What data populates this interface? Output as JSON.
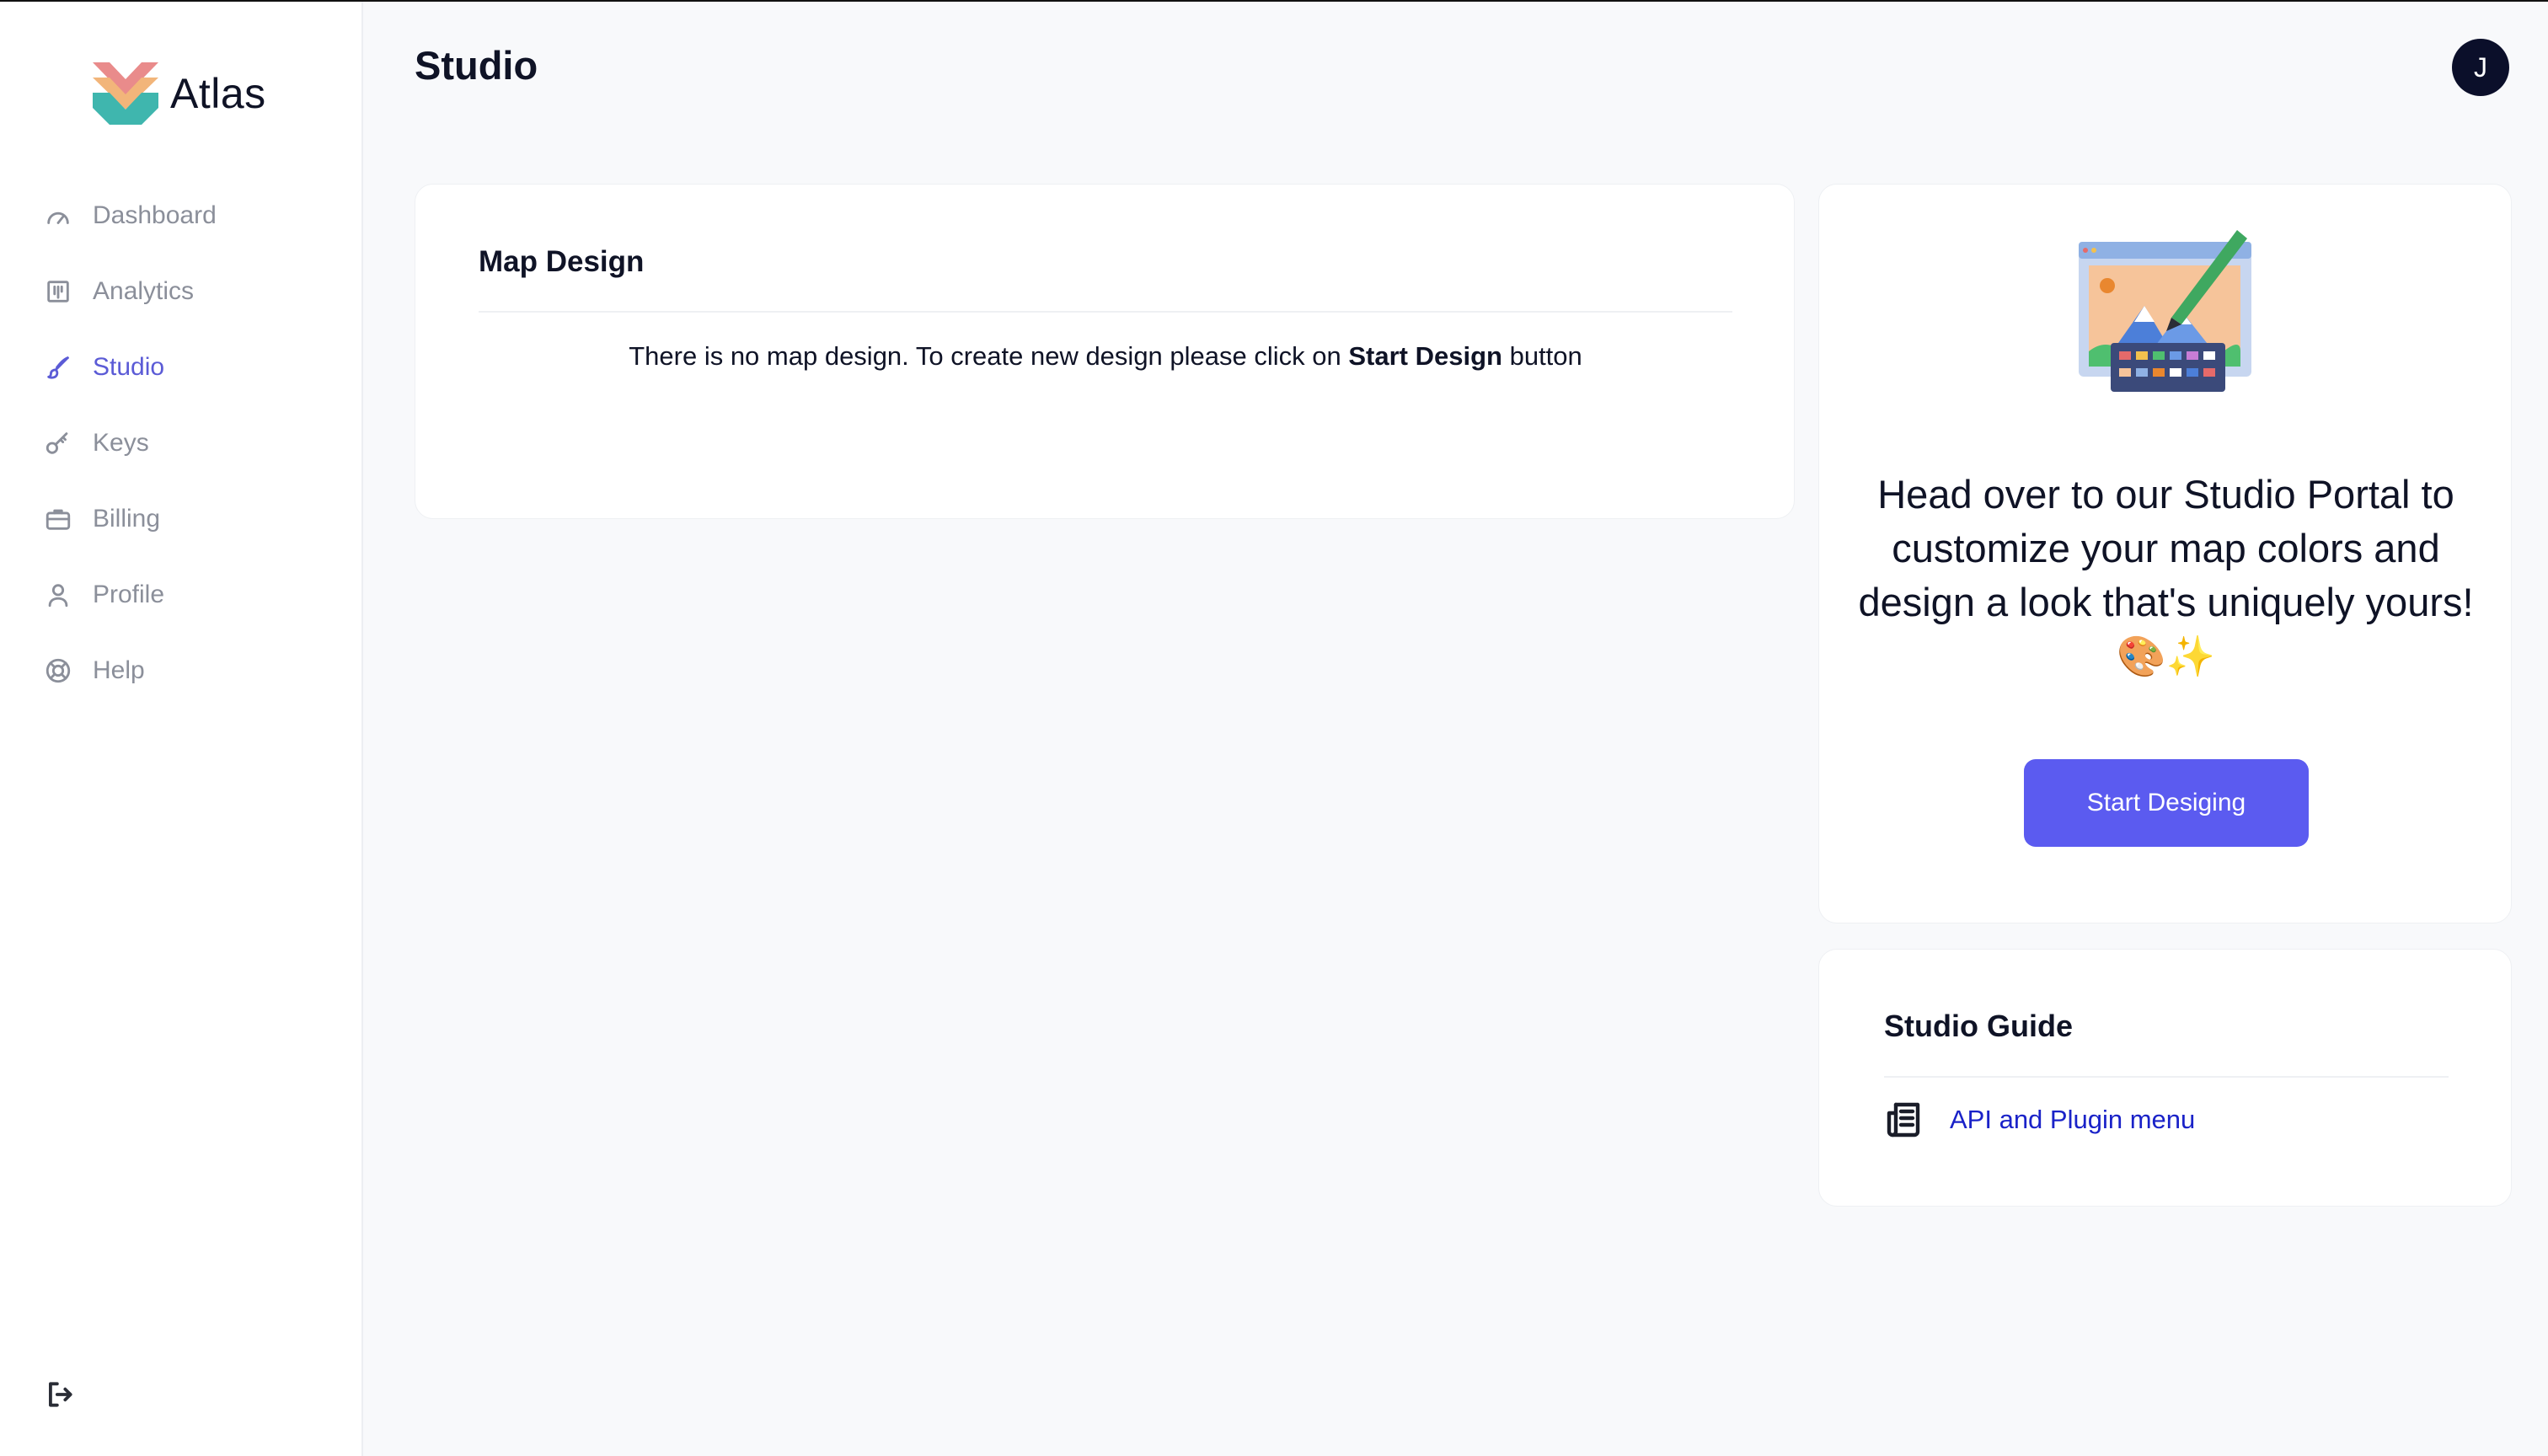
{
  "app": {
    "name": "Atlas",
    "accent": "#5b5bd6",
    "button_color": "#5b5bf0"
  },
  "sidebar": {
    "items": [
      {
        "label": "Dashboard",
        "icon": "gauge-icon",
        "active": false
      },
      {
        "label": "Analytics",
        "icon": "chart-icon",
        "active": false
      },
      {
        "label": "Studio",
        "icon": "brush-icon",
        "active": true
      },
      {
        "label": "Keys",
        "icon": "key-icon",
        "active": false
      },
      {
        "label": "Billing",
        "icon": "briefcase-icon",
        "active": false
      },
      {
        "label": "Profile",
        "icon": "user-icon",
        "active": false
      },
      {
        "label": "Help",
        "icon": "lifebuoy-icon",
        "active": false
      }
    ],
    "logout_icon": "logout-icon"
  },
  "header": {
    "title": "Studio",
    "avatar_initial": "J"
  },
  "map_design": {
    "title": "Map Design",
    "empty_prefix": "There is no map design. To create new design please click on ",
    "empty_bold": "Start Design",
    "empty_suffix": " button"
  },
  "promo": {
    "illustration": "design-palette-icon",
    "text": "Head over to our Studio Portal to customize your map colors and design a look that's uniquely yours! 🎨✨",
    "button_label": "Start Desiging"
  },
  "guide": {
    "title": "Studio Guide",
    "link_label": "API and Plugin menu",
    "link_icon": "newspaper-icon"
  }
}
